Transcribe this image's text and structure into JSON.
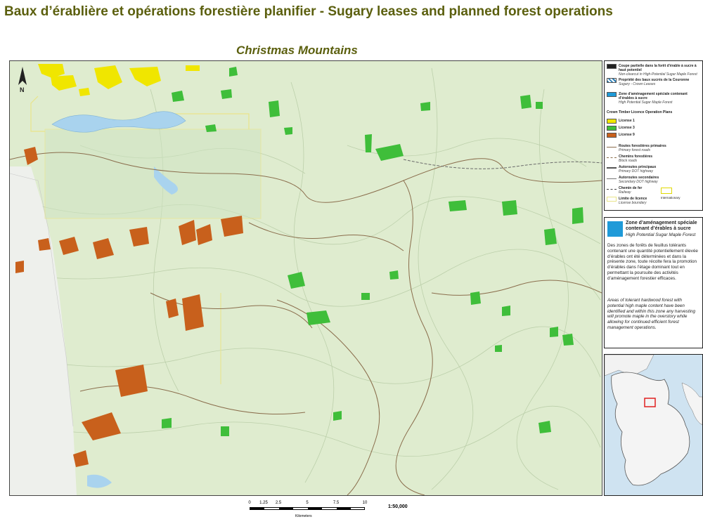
{
  "title": "Baux d’érablière et opérations forestière planifier - Sugary leases and planned forest operations",
  "subtitle": "Christmas Mountains",
  "north_arrow": {
    "letter": "N",
    "icon": "north-arrow-icon"
  },
  "legend": {
    "items_top": [
      {
        "fr": "Coupe partielle dans la forêt d'érable à sucre à haut potentiel",
        "en": "Non-clearcut in High-Potential Sugar Maple Forest",
        "swatch": "#222222"
      },
      {
        "fr": "Propriété des baux sucrés de la Couronne",
        "en": "Sugary - Crown Leases",
        "swatch": "#2a7fb8"
      },
      {
        "fr": "Zone d’aménagement spéciale contenant d’érables à sucre",
        "en": "High Potential Sugar Maple Forest",
        "swatch": "#1f9ad8"
      }
    ],
    "licence_heading": "Crown Timber Licence Operation Plans",
    "licences": [
      {
        "label": "License 1",
        "color": "#f0e600"
      },
      {
        "label": "License 3",
        "color": "#3fbe3a"
      },
      {
        "label": "License 9",
        "color": "#c8601c"
      }
    ],
    "lines": [
      {
        "fr": "Routes forestières primaires",
        "en": "Primary forest roads"
      },
      {
        "fr": "Chemins forestières",
        "en": "Block roads"
      },
      {
        "fr": "Autoroutes principaux",
        "en": "Primary DOT highway"
      },
      {
        "fr": "Autoroutes secondaires",
        "en": "Secondary DOT highway"
      },
      {
        "fr": "Chemin de fer",
        "en": "Railway"
      },
      {
        "fr": "Limite de licence",
        "en": "License boundary"
      }
    ],
    "boundary_label": "Internationary"
  },
  "zone": {
    "swatch_color": "#1f9ad8",
    "title_fr": "Zone d’aménagement spéciale contenant d’érables à sucre",
    "title_en": "High Potential Sugar Maple Forest",
    "desc_fr": "Des zones de forêts de feuillus tolérants contenant une quantité potentiellement élevée d’érables ont été déterminées et dans la présente zone, toute récolte fera la promotion d’érables dans l’étage dominant tout en permettant la poursuite des activités d’aménagement forestier efficaces.",
    "desc_en": "Areas of tolerant hardwood forest with potential high maple content have been identified and within this zone any harvesting will promote maple in the overstory while allowing for continued efficient forest management operations."
  },
  "scale": {
    "ticks": [
      "0",
      "1.25",
      "2.5",
      "5",
      "7.5",
      "10"
    ],
    "tick_values": [
      0,
      1.25,
      2.5,
      5,
      7.5,
      10
    ],
    "unit": "Kilometers",
    "ratio": "1:50,000"
  },
  "colors": {
    "map_bg": "#dfeccf",
    "water": "#a9d3ee",
    "license_boundary": "#e9e48a",
    "roads": "#8a6d4c",
    "contour": "#b4c9a2",
    "locator": "#e02020"
  }
}
